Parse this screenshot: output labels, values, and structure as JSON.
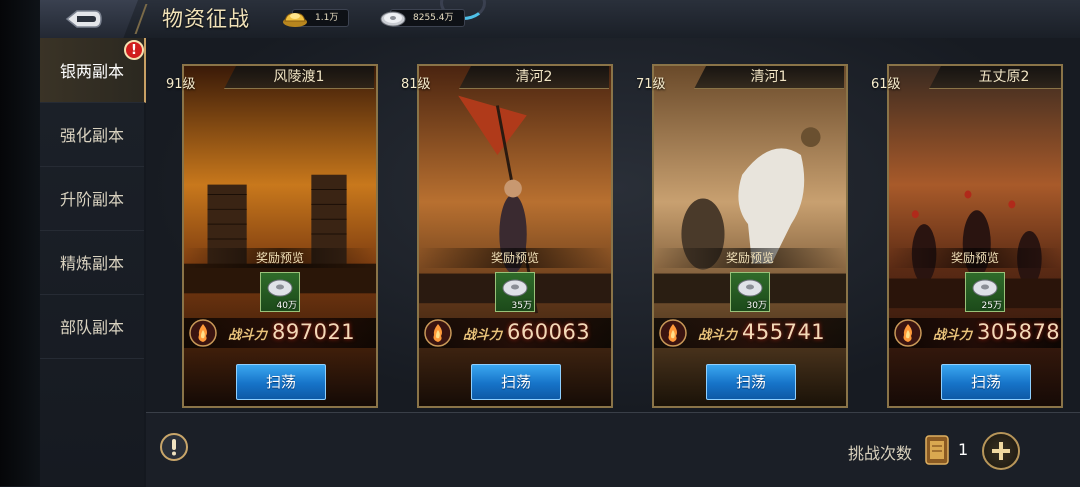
{
  "header": {
    "title": "物资征战",
    "gold_amount": "1.1万",
    "silver_amount": "8255.4万"
  },
  "sidebar": {
    "items": [
      {
        "label": "银两副本",
        "active": true,
        "alert": "!"
      },
      {
        "label": "强化副本"
      },
      {
        "label": "升阶副本"
      },
      {
        "label": "精炼副本"
      },
      {
        "label": "部队副本"
      }
    ]
  },
  "cards": [
    {
      "level": "91级",
      "name": "风陵渡1",
      "reward_title": "奖励预览",
      "reward_amount": "40万",
      "power_label": "战斗力",
      "power": "897021",
      "sweep": "扫荡",
      "scene": "ships"
    },
    {
      "level": "81级",
      "name": "清河2",
      "reward_title": "奖励预览",
      "reward_amount": "35万",
      "power_label": "战斗力",
      "power": "660063",
      "sweep": "扫荡",
      "scene": "warrior"
    },
    {
      "level": "71级",
      "name": "清河1",
      "reward_title": "奖励预览",
      "reward_amount": "30万",
      "power_label": "战斗力",
      "power": "455741",
      "sweep": "扫荡",
      "scene": "horse"
    },
    {
      "level": "61级",
      "name": "五丈原2",
      "reward_title": "奖励预览",
      "reward_amount": "25万",
      "power_label": "战斗力",
      "power": "305878",
      "sweep": "扫荡",
      "scene": "battle"
    }
  ],
  "footer": {
    "info_icon": "exclamation-icon",
    "attempts_label": "挑战次数",
    "attempts_count": "1",
    "add_icon": "plus-icon"
  },
  "colors": {
    "sweep_button": "#1673c8",
    "frame_gold": "#8a7448",
    "alert_red": "#d11e1e"
  }
}
